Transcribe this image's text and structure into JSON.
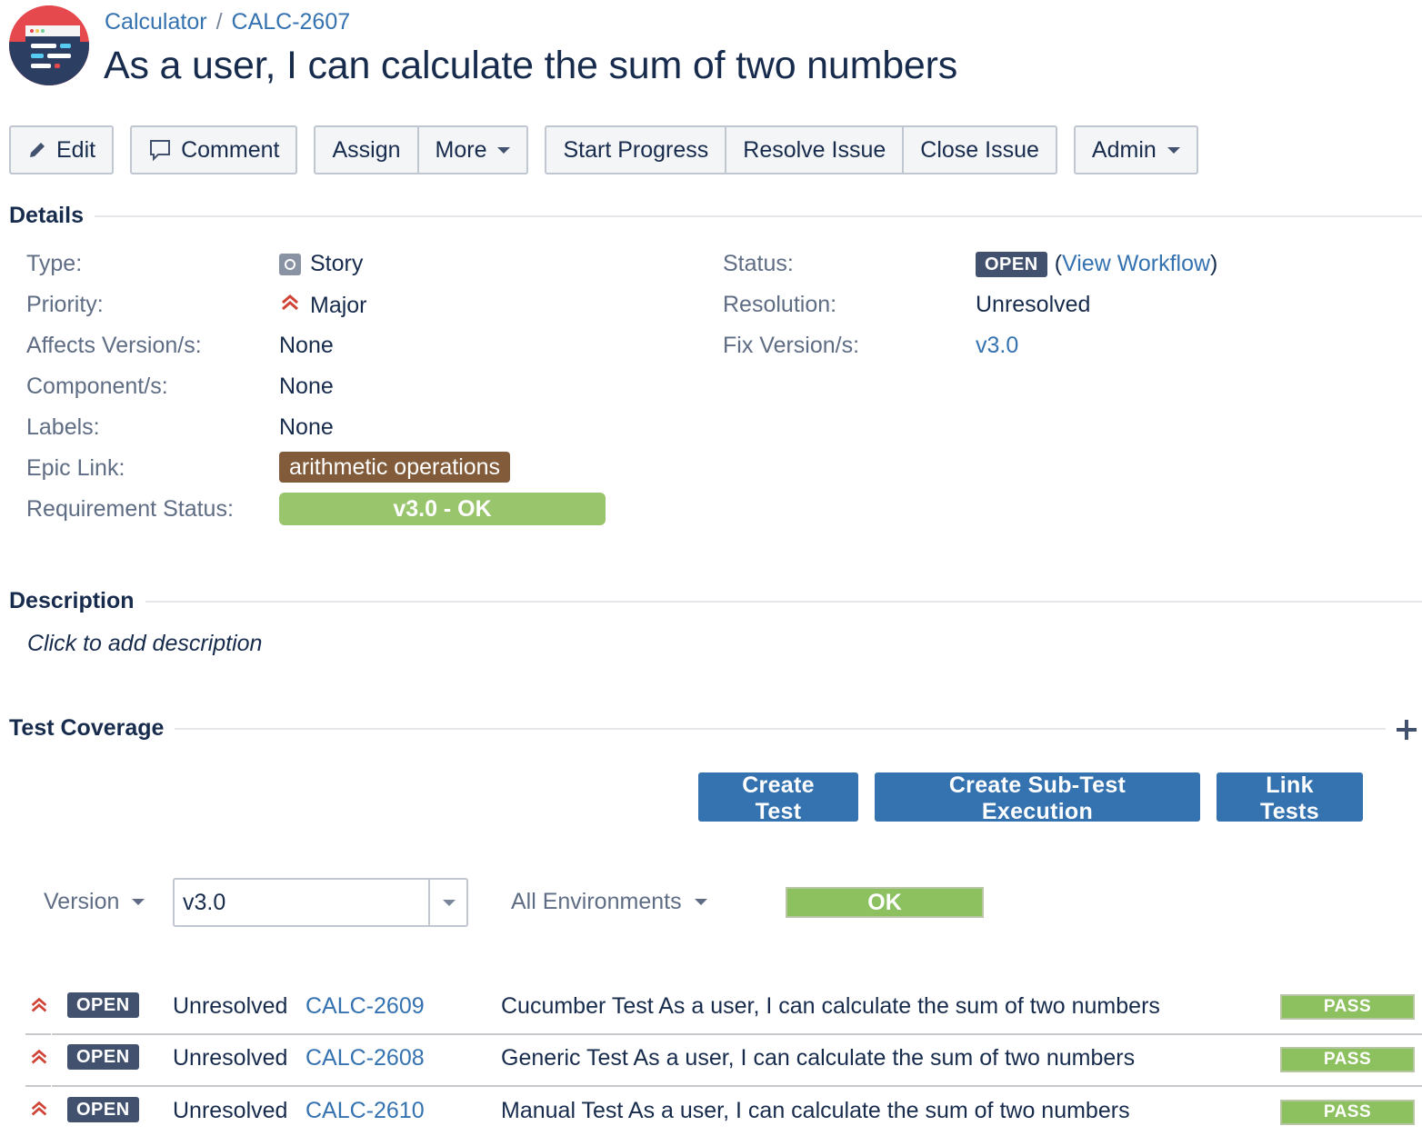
{
  "breadcrumb": {
    "project": "Calculator",
    "separator": "/",
    "issue_key": "CALC-2607"
  },
  "title": "As a user, I can calculate the sum of two numbers",
  "toolbar": {
    "edit": "Edit",
    "comment": "Comment",
    "assign": "Assign",
    "more": "More",
    "start_progress": "Start Progress",
    "resolve_issue": "Resolve Issue",
    "close_issue": "Close Issue",
    "admin": "Admin"
  },
  "details": {
    "heading": "Details",
    "type_label": "Type:",
    "type_value": "Story",
    "priority_label": "Priority:",
    "priority_value": "Major",
    "affects_label": "Affects Version/s:",
    "affects_value": "None",
    "components_label": "Component/s:",
    "components_value": "None",
    "labels_label": "Labels:",
    "labels_value": "None",
    "epic_label": "Epic Link:",
    "epic_value": "arithmetic operations",
    "req_status_label": "Requirement Status:",
    "req_status_value": "v3.0 - OK",
    "status_label": "Status:",
    "status_value": "OPEN",
    "workflow_open": "(",
    "workflow_link": "View Workflow",
    "workflow_close": ")",
    "resolution_label": "Resolution:",
    "resolution_value": "Unresolved",
    "fix_label": "Fix Version/s:",
    "fix_value": "v3.0"
  },
  "description": {
    "heading": "Description",
    "placeholder": "Click to add description"
  },
  "test_coverage": {
    "heading": "Test Coverage",
    "create_test": "Create Test",
    "create_sub_exec": "Create Sub-Test Execution",
    "link_tests": "Link Tests",
    "version_label": "Version",
    "version_value": "v3.0",
    "environments": "All Environments",
    "overall_status": "OK",
    "tests": [
      {
        "status": "OPEN",
        "resolution": "Unresolved",
        "key": "CALC-2609",
        "summary": "Cucumber Test As a user, I can calculate the sum of two numbers",
        "result": "PASS"
      },
      {
        "status": "OPEN",
        "resolution": "Unresolved",
        "key": "CALC-2608",
        "summary": "Generic Test As a user, I can calculate the sum of two numbers",
        "result": "PASS"
      },
      {
        "status": "OPEN",
        "resolution": "Unresolved",
        "key": "CALC-2610",
        "summary": "Manual Test As a user, I can calculate the sum of two numbers",
        "result": "PASS"
      }
    ]
  },
  "colors": {
    "link": "#3572b0",
    "primary_button": "#3572b0",
    "ok_green": "#99c56c",
    "epic_brown": "#815b3a",
    "open_lozenge": "#42526e",
    "priority_red": "#d04437",
    "logo_red": "#e5484d"
  },
  "icons": {
    "logo": "project-avatar-icon",
    "edit": "pencil-icon",
    "comment": "speech-bubble-icon",
    "type": "story-type-icon",
    "priority": "major-priority-icon",
    "add": "plus-icon"
  }
}
